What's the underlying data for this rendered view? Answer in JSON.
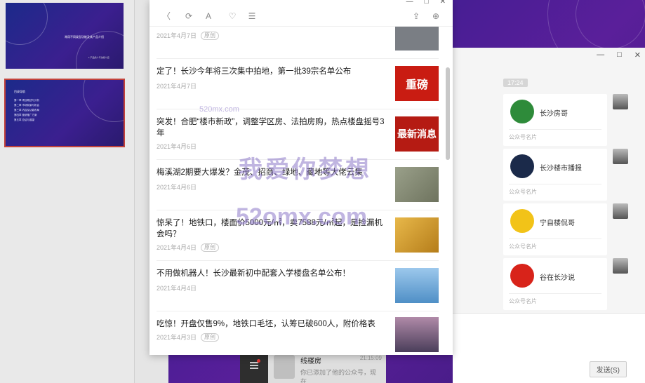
{
  "slides": [
    {
      "title": "常用不同类型功能及其产品介绍",
      "subtitle": "1.产品简介与功能介绍"
    },
    {
      "title": "目录导航",
      "items": [
        "第一章  项目概述与分析",
        "第二章  市场前景与机会",
        "第三章  内容及功能布局",
        "第四章  营销推广方案",
        "第五章  总结与展望"
      ]
    }
  ],
  "popup": {
    "toolbar": {
      "back": "〈",
      "refresh": "⟳",
      "font": "A",
      "favorite": "♡",
      "more": "☰",
      "share": "⇪",
      "browser": "⊕"
    },
    "window_controls": [
      "—",
      "□",
      "✕"
    ],
    "articles": [
      {
        "title": "",
        "date": "2021年4月7日",
        "badge": "原创",
        "thumb_color": "#7a7e84"
      },
      {
        "title": "定了！长沙今年将三次集中拍地，第一批39宗名单公布",
        "date": "2021年4月7日",
        "badge": "",
        "thumb_text": "重磅",
        "thumb_color": "#c91c12"
      },
      {
        "title": "突发！合肥“楼市新政”，调整学区房、法拍房购，热点楼盘摇号3年",
        "date": "2021年4月6日",
        "badge": "",
        "thumb_text": "最新消息",
        "thumb_color": "#b51b13"
      },
      {
        "title": "梅溪湖2期要大爆发？金茂、招商、绿地、藏地等大佬云集",
        "date": "2021年4月6日",
        "badge": "",
        "thumb_color": "#8a8f7a"
      },
      {
        "title": "惊呆了！地铁口，楼面价5000元/㎡，卖7588元/㎡起，是捡漏机会吗？",
        "date": "2021年4月4日",
        "badge": "原创",
        "thumb_color": "#d2992a"
      },
      {
        "title": "不用做机器人！长沙最新初中配套入学楼盘名单公布！",
        "date": "2021年4月4日",
        "badge": "",
        "thumb_color": "#6aa7d8"
      },
      {
        "title": "吃惊！开盘仅售9%，地铁口毛坯，认筹已破600人，附价格表",
        "date": "2021年4月3日",
        "badge": "原创",
        "thumb_color": "#6e5a7a"
      }
    ]
  },
  "chat": {
    "tag": "17:24",
    "window_controls": [
      "—",
      "□",
      "✕"
    ],
    "cards": [
      {
        "name": "长沙房哥",
        "sub": "公众号名片",
        "avatar_color": "#2e8b3a"
      },
      {
        "name": "长沙楼市播报",
        "sub": "公众号名片",
        "avatar_color": "#1b2a4a"
      },
      {
        "name": "宁自楼侃哥",
        "sub": "公众号名片",
        "avatar_color": "#f2c318"
      },
      {
        "name": "谷在长沙说",
        "sub": "公众号名片",
        "avatar_color": "#d8231a"
      }
    ],
    "send_button": "发送(S)",
    "conversation": {
      "name": "线楼房",
      "time": "21:15:09",
      "preview": "你已添加了他的公众号，现在..."
    }
  },
  "watermarks": {
    "domain": "52omx.com",
    "slogan": "我爱你梦想",
    "small": "520mx.com"
  }
}
